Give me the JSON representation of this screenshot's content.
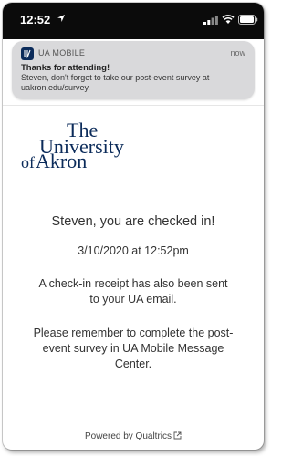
{
  "status_bar": {
    "time": "12:52",
    "icons": [
      "location-arrow-icon",
      "signal-icon",
      "wifi-icon",
      "battery-icon"
    ]
  },
  "notification": {
    "app_name": "UA MOBILE",
    "time": "now",
    "title": "Thanks for attending!",
    "body": "Steven, don't forget to take our post-event survey at uakron.edu/survey."
  },
  "logo": {
    "line1": "The",
    "line2": "University",
    "line3_prefix": "of",
    "line3_main": "Akron",
    "color": "#0b2b5a"
  },
  "main": {
    "headline": "Steven, you are checked in!",
    "date": "3/10/2020 at 12:52pm",
    "receipt": "A check-in receipt has also been sent to your UA email.",
    "reminder": "Please remember to complete the post-event survey in UA Mobile Message Center."
  },
  "footer": {
    "text": "Powered by Qualtrics",
    "icon": "external-link-icon"
  }
}
